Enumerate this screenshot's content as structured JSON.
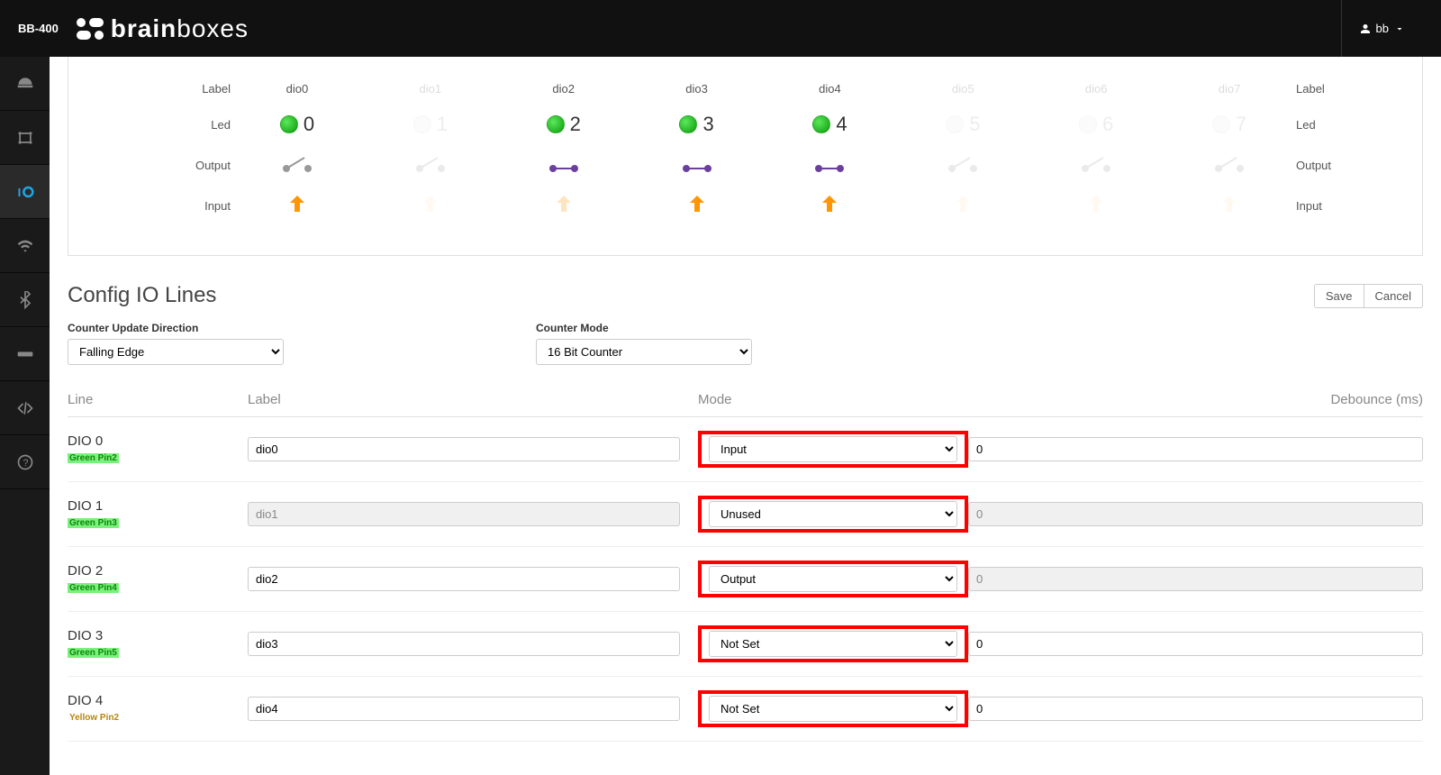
{
  "topbar": {
    "model": "BB-400",
    "brand_bold": "brain",
    "brand_light": "boxes",
    "user": "bb"
  },
  "rowlabels": {
    "label_l": "Label",
    "led_l": "Led",
    "output_l": "Output",
    "input_l": "Input",
    "label_r": "Label",
    "led_r": "Led",
    "output_r": "Output",
    "input_r": "Input"
  },
  "dio_cols": [
    {
      "name": "dio0",
      "num": "0",
      "active": true,
      "led": true,
      "switch": "open",
      "arrow": true
    },
    {
      "name": "dio1",
      "num": "1",
      "active": false,
      "led": false,
      "switch": "open",
      "arrow": false
    },
    {
      "name": "dio2",
      "num": "2",
      "active": true,
      "led": true,
      "switch": "closed",
      "arrow": false
    },
    {
      "name": "dio3",
      "num": "3",
      "active": true,
      "led": true,
      "switch": "closed",
      "arrow": true
    },
    {
      "name": "dio4",
      "num": "4",
      "active": true,
      "led": true,
      "switch": "closed",
      "arrow": true
    },
    {
      "name": "dio5",
      "num": "5",
      "active": false,
      "led": false,
      "switch": "open",
      "arrow": false
    },
    {
      "name": "dio6",
      "num": "6",
      "active": false,
      "led": false,
      "switch": "open",
      "arrow": false
    },
    {
      "name": "dio7",
      "num": "7",
      "active": false,
      "led": false,
      "switch": "open",
      "arrow": false
    }
  ],
  "config": {
    "title": "Config IO Lines",
    "save": "Save",
    "cancel": "Cancel",
    "cud_label": "Counter Update Direction",
    "cud_value": "Falling Edge",
    "cm_label": "Counter Mode",
    "cm_value": "16 Bit Counter"
  },
  "th": {
    "line": "Line",
    "label": "Label",
    "mode": "Mode",
    "deb": "Debounce (ms)"
  },
  "rows": [
    {
      "line": "DIO 0",
      "pin": "Green Pin2",
      "pin_cls": "pin-green",
      "label": "dio0",
      "mode": "Input",
      "deb": "0",
      "label_en": true,
      "deb_en": true
    },
    {
      "line": "DIO 1",
      "pin": "Green Pin3",
      "pin_cls": "pin-green",
      "label": "dio1",
      "mode": "Unused",
      "deb": "0",
      "label_en": false,
      "deb_en": false
    },
    {
      "line": "DIO 2",
      "pin": "Green Pin4",
      "pin_cls": "pin-green",
      "label": "dio2",
      "mode": "Output",
      "deb": "0",
      "label_en": true,
      "deb_en": false
    },
    {
      "line": "DIO 3",
      "pin": "Green Pin5",
      "pin_cls": "pin-green",
      "label": "dio3",
      "mode": "Not Set",
      "deb": "0",
      "label_en": true,
      "deb_en": true
    },
    {
      "line": "DIO 4",
      "pin": "Yellow Pin2",
      "pin_cls": "pin-yellow",
      "label": "dio4",
      "mode": "Not Set",
      "deb": "0",
      "label_en": true,
      "deb_en": true
    }
  ]
}
